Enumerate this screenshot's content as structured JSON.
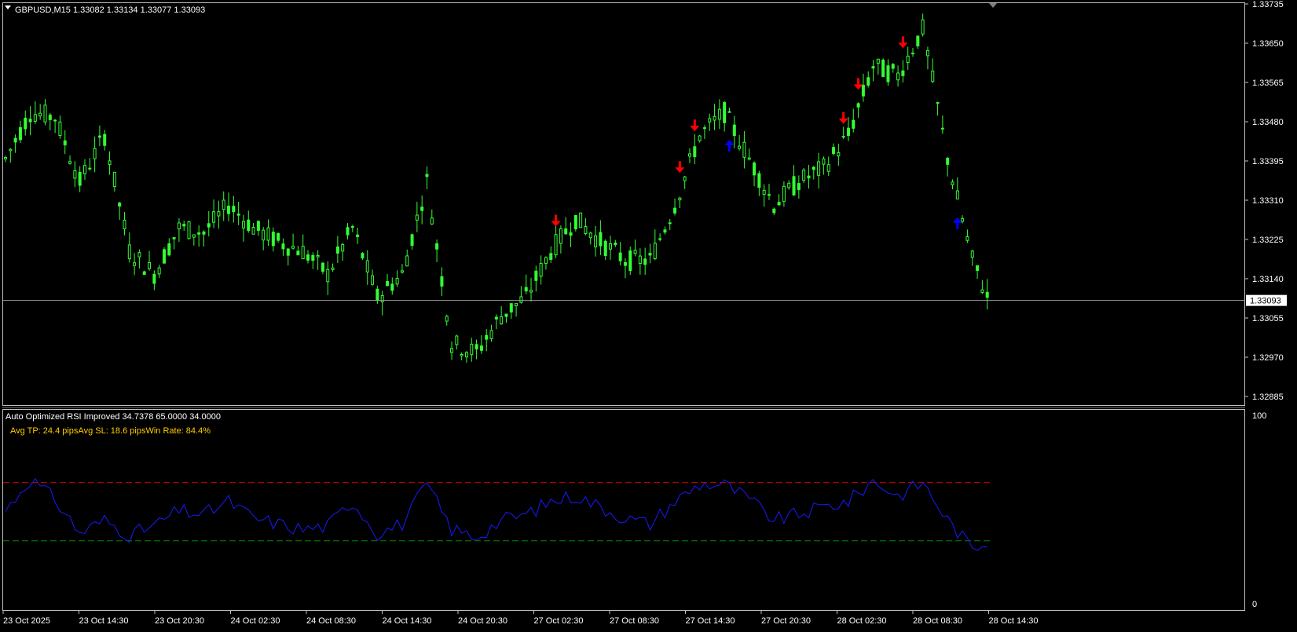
{
  "header": {
    "symbol_line": "GBPUSD,M15  1.33082 1.33134 1.33077 1.33093"
  },
  "indicator": {
    "title_line": "Auto Optimized RSI Improved 34.7378 65.0000 34.0000",
    "stats_line": "Avg TP: 24.4 pipsAvg SL: 18.6 pipsWin Rate: 84.4%",
    "axis_labels": [
      "100",
      "0"
    ]
  },
  "price_axis": {
    "labels": [
      "1.33735",
      "1.33650",
      "1.33565",
      "1.33480",
      "1.33395",
      "1.33310",
      "1.33225",
      "1.33140",
      "1.33055",
      "1.32970",
      "1.32885"
    ],
    "current_price": "1.33093"
  },
  "time_axis": {
    "labels": [
      "23 Oct 2025",
      "23 Oct 14:30",
      "23 Oct 20:30",
      "24 Oct 02:30",
      "24 Oct 08:30",
      "24 Oct 14:30",
      "24 Oct 20:30",
      "27 Oct 02:30",
      "27 Oct 08:30",
      "27 Oct 14:30",
      "27 Oct 20:30",
      "28 Oct 02:30",
      "28 Oct 08:30",
      "28 Oct 14:30"
    ]
  },
  "colors": {
    "background": "#000000",
    "candles": "#33ff33",
    "sell_arrow": "#ff0000",
    "buy_arrow": "#0000ff",
    "rsi_line": "#1a1aff",
    "overbought_line": "#cc0000",
    "oversold_line": "#008800",
    "grid_frame": "#c0c0c0",
    "stats_text": "#ffcc00"
  },
  "chart_data": {
    "type": "line",
    "price_series": {
      "name": "GBPUSD,M15",
      "x_index": [
        0,
        5,
        10,
        15,
        20,
        25,
        30,
        35,
        40,
        45,
        50,
        55,
        60,
        65,
        70,
        75,
        80,
        85,
        90,
        95,
        100,
        105,
        110,
        115,
        120,
        125,
        130,
        135,
        140,
        145,
        150,
        155,
        160,
        165,
        170,
        175,
        180,
        185,
        190,
        195,
        198
      ],
      "close": [
        1.334,
        1.335,
        1.3349,
        1.3335,
        1.3345,
        1.332,
        1.3315,
        1.3325,
        1.3324,
        1.333,
        1.3325,
        1.3322,
        1.332,
        1.3315,
        1.3325,
        1.331,
        1.3315,
        1.3335,
        1.33,
        1.3298,
        1.3306,
        1.331,
        1.332,
        1.3327,
        1.3322,
        1.3318,
        1.3318,
        1.333,
        1.3345,
        1.335,
        1.334,
        1.333,
        1.3335,
        1.3338,
        1.3345,
        1.336,
        1.3358,
        1.3368,
        1.334,
        1.3318,
        1.331
      ],
      "ylim": [
        1.32885,
        1.33735
      ]
    },
    "rsi_series": {
      "name": "Auto Optimized RSI Improved",
      "x_index": [
        0,
        5,
        10,
        15,
        20,
        25,
        30,
        35,
        40,
        45,
        50,
        55,
        60,
        65,
        70,
        75,
        80,
        85,
        90,
        95,
        100,
        105,
        110,
        115,
        120,
        125,
        130,
        135,
        140,
        145,
        150,
        155,
        160,
        165,
        170,
        175,
        180,
        185,
        190,
        195,
        198
      ],
      "values": [
        50,
        67,
        56,
        38,
        45,
        37,
        42,
        50,
        48,
        55,
        46,
        43,
        40,
        42,
        55,
        38,
        43,
        64,
        40,
        36,
        45,
        48,
        55,
        58,
        52,
        46,
        43,
        55,
        64,
        64,
        56,
        45,
        48,
        52,
        55,
        66,
        58,
        65,
        45,
        30,
        34
      ],
      "ylim": [
        0,
        100
      ]
    },
    "levels": {
      "overbought": 65,
      "oversold": 34
    },
    "sell_signals_at_index": [
      111,
      136,
      139,
      169,
      172,
      181
    ],
    "buy_signals_at_index": [
      146,
      192
    ]
  }
}
